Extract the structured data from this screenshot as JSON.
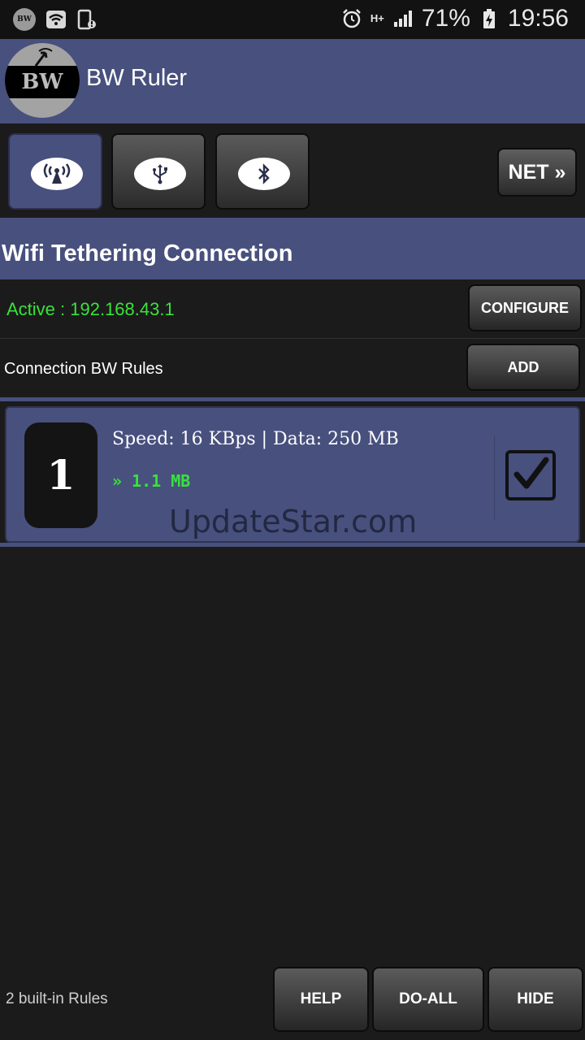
{
  "status_bar": {
    "app_icon_text": "BW",
    "battery": "71%",
    "time": "19:56",
    "network_type": "H+"
  },
  "app": {
    "title": "BW Ruler",
    "logo_text": "BW"
  },
  "modes": {
    "items": [
      {
        "icon": "wifi-hotspot-icon",
        "active": true
      },
      {
        "icon": "usb-icon",
        "active": false
      },
      {
        "icon": "bluetooth-icon",
        "active": false
      }
    ],
    "net_label": "NET »"
  },
  "section": {
    "title": "Wifi Tethering Connection"
  },
  "connection": {
    "status": "Active : 192.168.43.1",
    "configure_label": "CONFIGURE",
    "rules_label": "Connection BW Rules",
    "add_label": "ADD"
  },
  "rules": [
    {
      "number": "1",
      "info": "Speed: 16 KBps | Data: 250 MB",
      "usage": "» 1.1 MB",
      "enabled": true
    }
  ],
  "watermark": "UpdateStar.com",
  "footer": {
    "builtin_label": "2 built-in Rules",
    "help_label": "HELP",
    "doall_label": "DO-ALL",
    "hide_label": "HIDE"
  },
  "colors": {
    "accent": "#48507e",
    "active_green": "#39e23a",
    "background": "#1c1b1c"
  }
}
